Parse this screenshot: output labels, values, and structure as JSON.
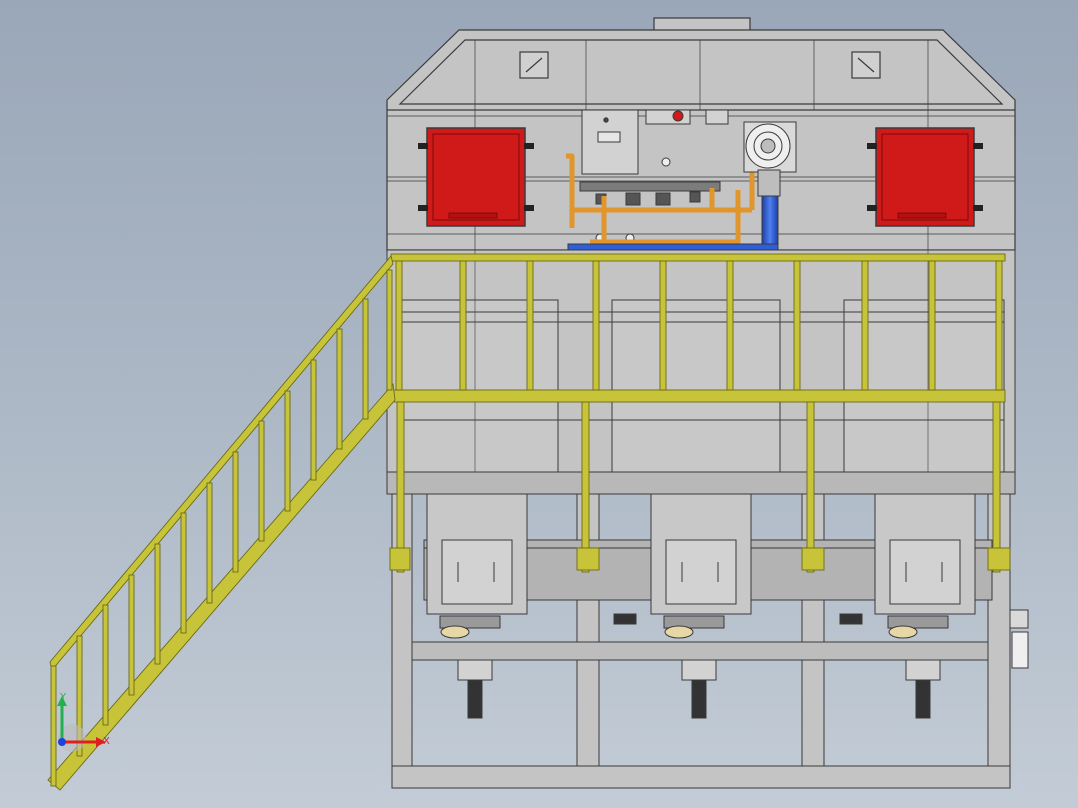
{
  "viewport": {
    "background_top": "#9aa7b8",
    "background_bottom": "#c3ccd6"
  },
  "colors": {
    "housing": "#c4c4c4",
    "housing_dark": "#a9a9a9",
    "outline": "#3a3a3a",
    "railing": "#c7c43a",
    "railing_dark": "#8c8a1e",
    "door": "#d01a1a",
    "pipe_orange": "#e0962c",
    "pipe_blue": "#2f5fd8"
  },
  "triad": {
    "y_label": "Y",
    "x_label": "X",
    "y_color": "#22b14c",
    "x_color": "#e02020",
    "z_color": "#2040e0"
  },
  "equipment": {
    "filter_chamber_count": 3,
    "access_door_count": 2
  }
}
